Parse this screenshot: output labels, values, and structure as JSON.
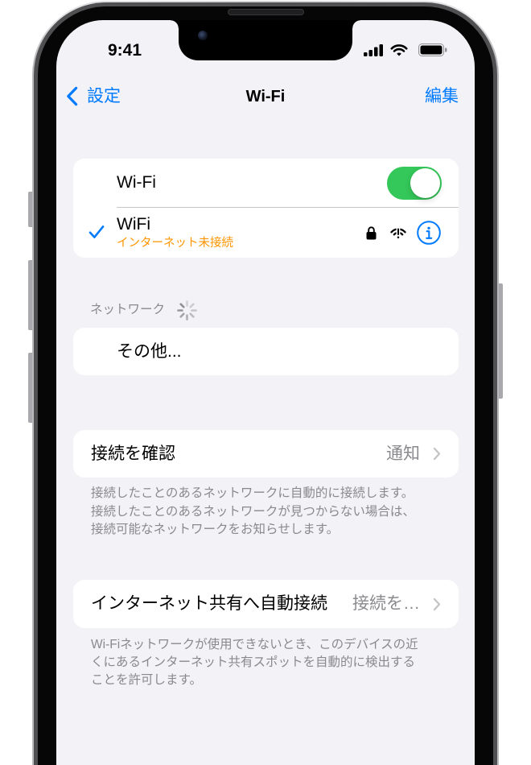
{
  "status_bar": {
    "time": "9:41",
    "signal_icon": "cellular-signal-icon",
    "wifi_icon": "wifi-icon",
    "battery_icon": "battery-icon"
  },
  "nav": {
    "back_icon": "chevron-left-icon",
    "back_label": "設定",
    "title": "Wi-Fi",
    "edit_label": "編集"
  },
  "wifi_group": {
    "toggle_label": "Wi-Fi",
    "toggle_on": true,
    "current_network": {
      "selected_icon": "checkmark-icon",
      "name": "WiFi",
      "status": "インターネット未接続",
      "lock_icon": "lock-icon",
      "signal_icon": "wifi-exclamationmark-icon",
      "info_icon": "info-icon"
    }
  },
  "networks_section": {
    "header": "ネットワーク",
    "spinner_icon": "activity-indicator-icon",
    "other_label": "その他..."
  },
  "ask_to_join": {
    "label": "接続を確認",
    "value": "通知",
    "chevron_icon": "chevron-right-icon",
    "footer": [
      "接続したことのあるネットワークに自動的に接続します。",
      "接続したことのあるネットワークが見つからない場合は、",
      "接続可能なネットワークをお知らせします。"
    ]
  },
  "auto_join_hotspot": {
    "label": "インターネット共有へ自動接続",
    "value": "接続を…",
    "chevron_icon": "chevron-right-icon",
    "footer": [
      "Wi-Fiネットワークが使用できないとき、このデバイスの近",
      "くにあるインターネット共有スポットを自動的に検出する",
      "ことを許可します。"
    ]
  },
  "colors": {
    "accent": "#007aff",
    "toggle_on": "#34c759",
    "warning": "#ff9500",
    "background": "#f2f2f7",
    "secondary_text": "#8a8a8e"
  }
}
